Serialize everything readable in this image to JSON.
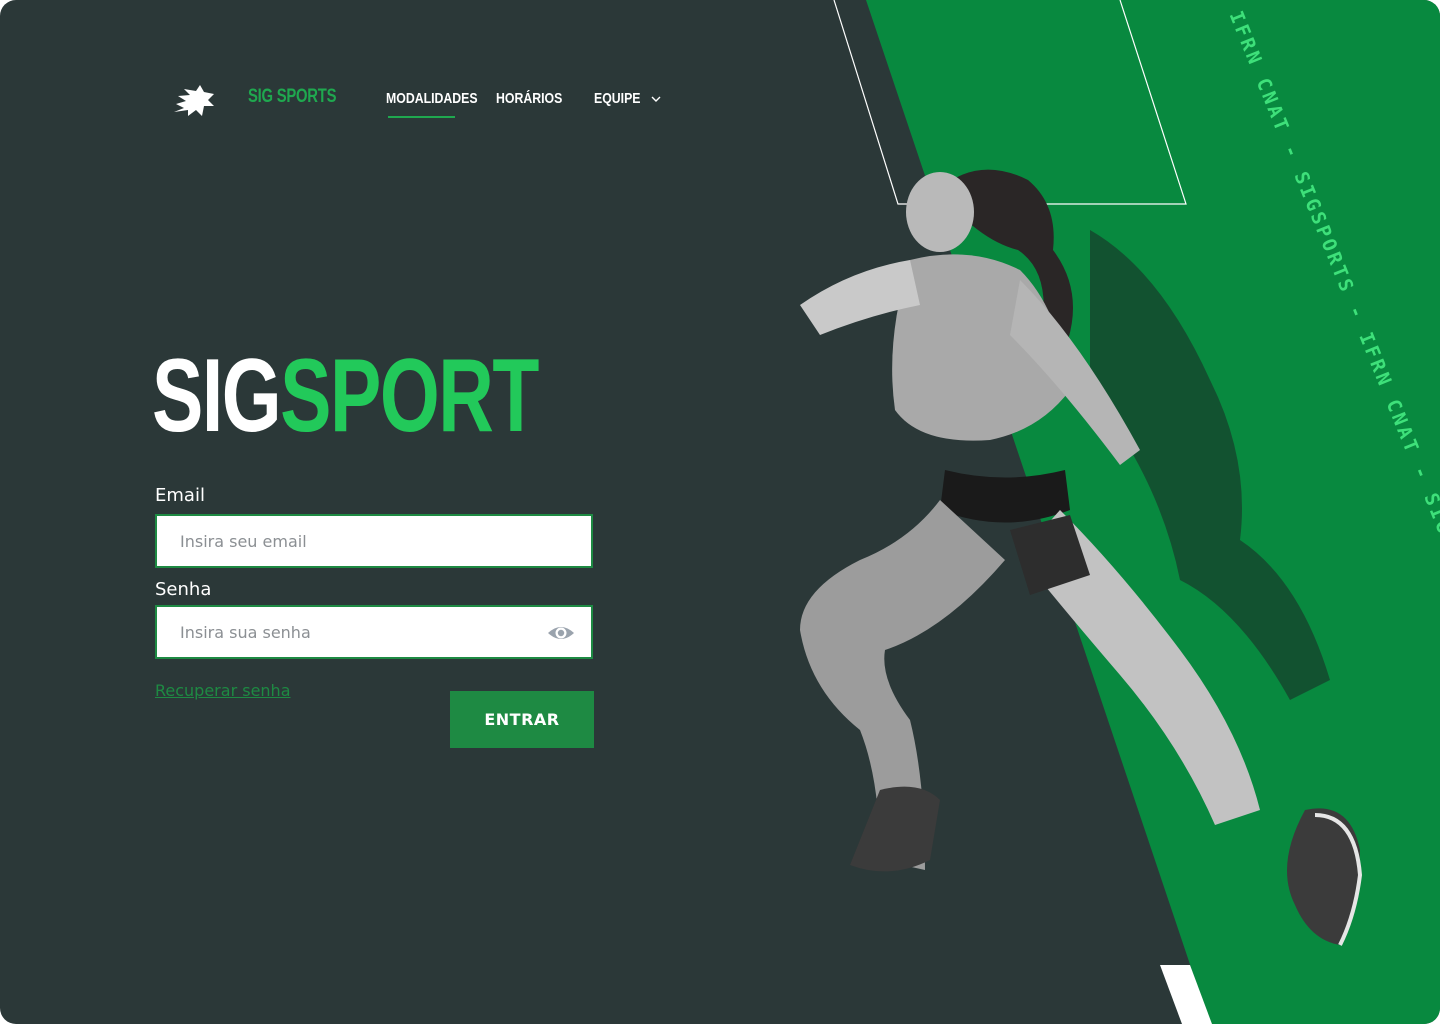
{
  "nav": {
    "brand": "SIG SPORTS",
    "items": [
      {
        "label": "MODALIDADES",
        "active": true
      },
      {
        "label": "HORÁRIOS",
        "active": false
      },
      {
        "label": "EQUIPE",
        "active": false,
        "dropdown": true
      }
    ]
  },
  "hero": {
    "title_white": "SIG",
    "title_green": "SPORT"
  },
  "form": {
    "email_label": "Email",
    "email_placeholder": "Insira seu email",
    "password_label": "Senha",
    "password_placeholder": "Insira sua senha",
    "recover_link": "Recuperar senha",
    "submit_label": "ENTRAR"
  },
  "ribbon_text": "IFRN CNAT - SIGSPORTS - IFRN CNAT - SIGSPORTS - IFRN CNAT",
  "icons": [
    "lion-logo-icon",
    "chevron-down-icon",
    "eye-icon"
  ],
  "colors": {
    "background": "#2b3838",
    "accent_green": "#1e8a43",
    "bright_green": "#22c95a",
    "ribbon_green": "#08893f"
  }
}
